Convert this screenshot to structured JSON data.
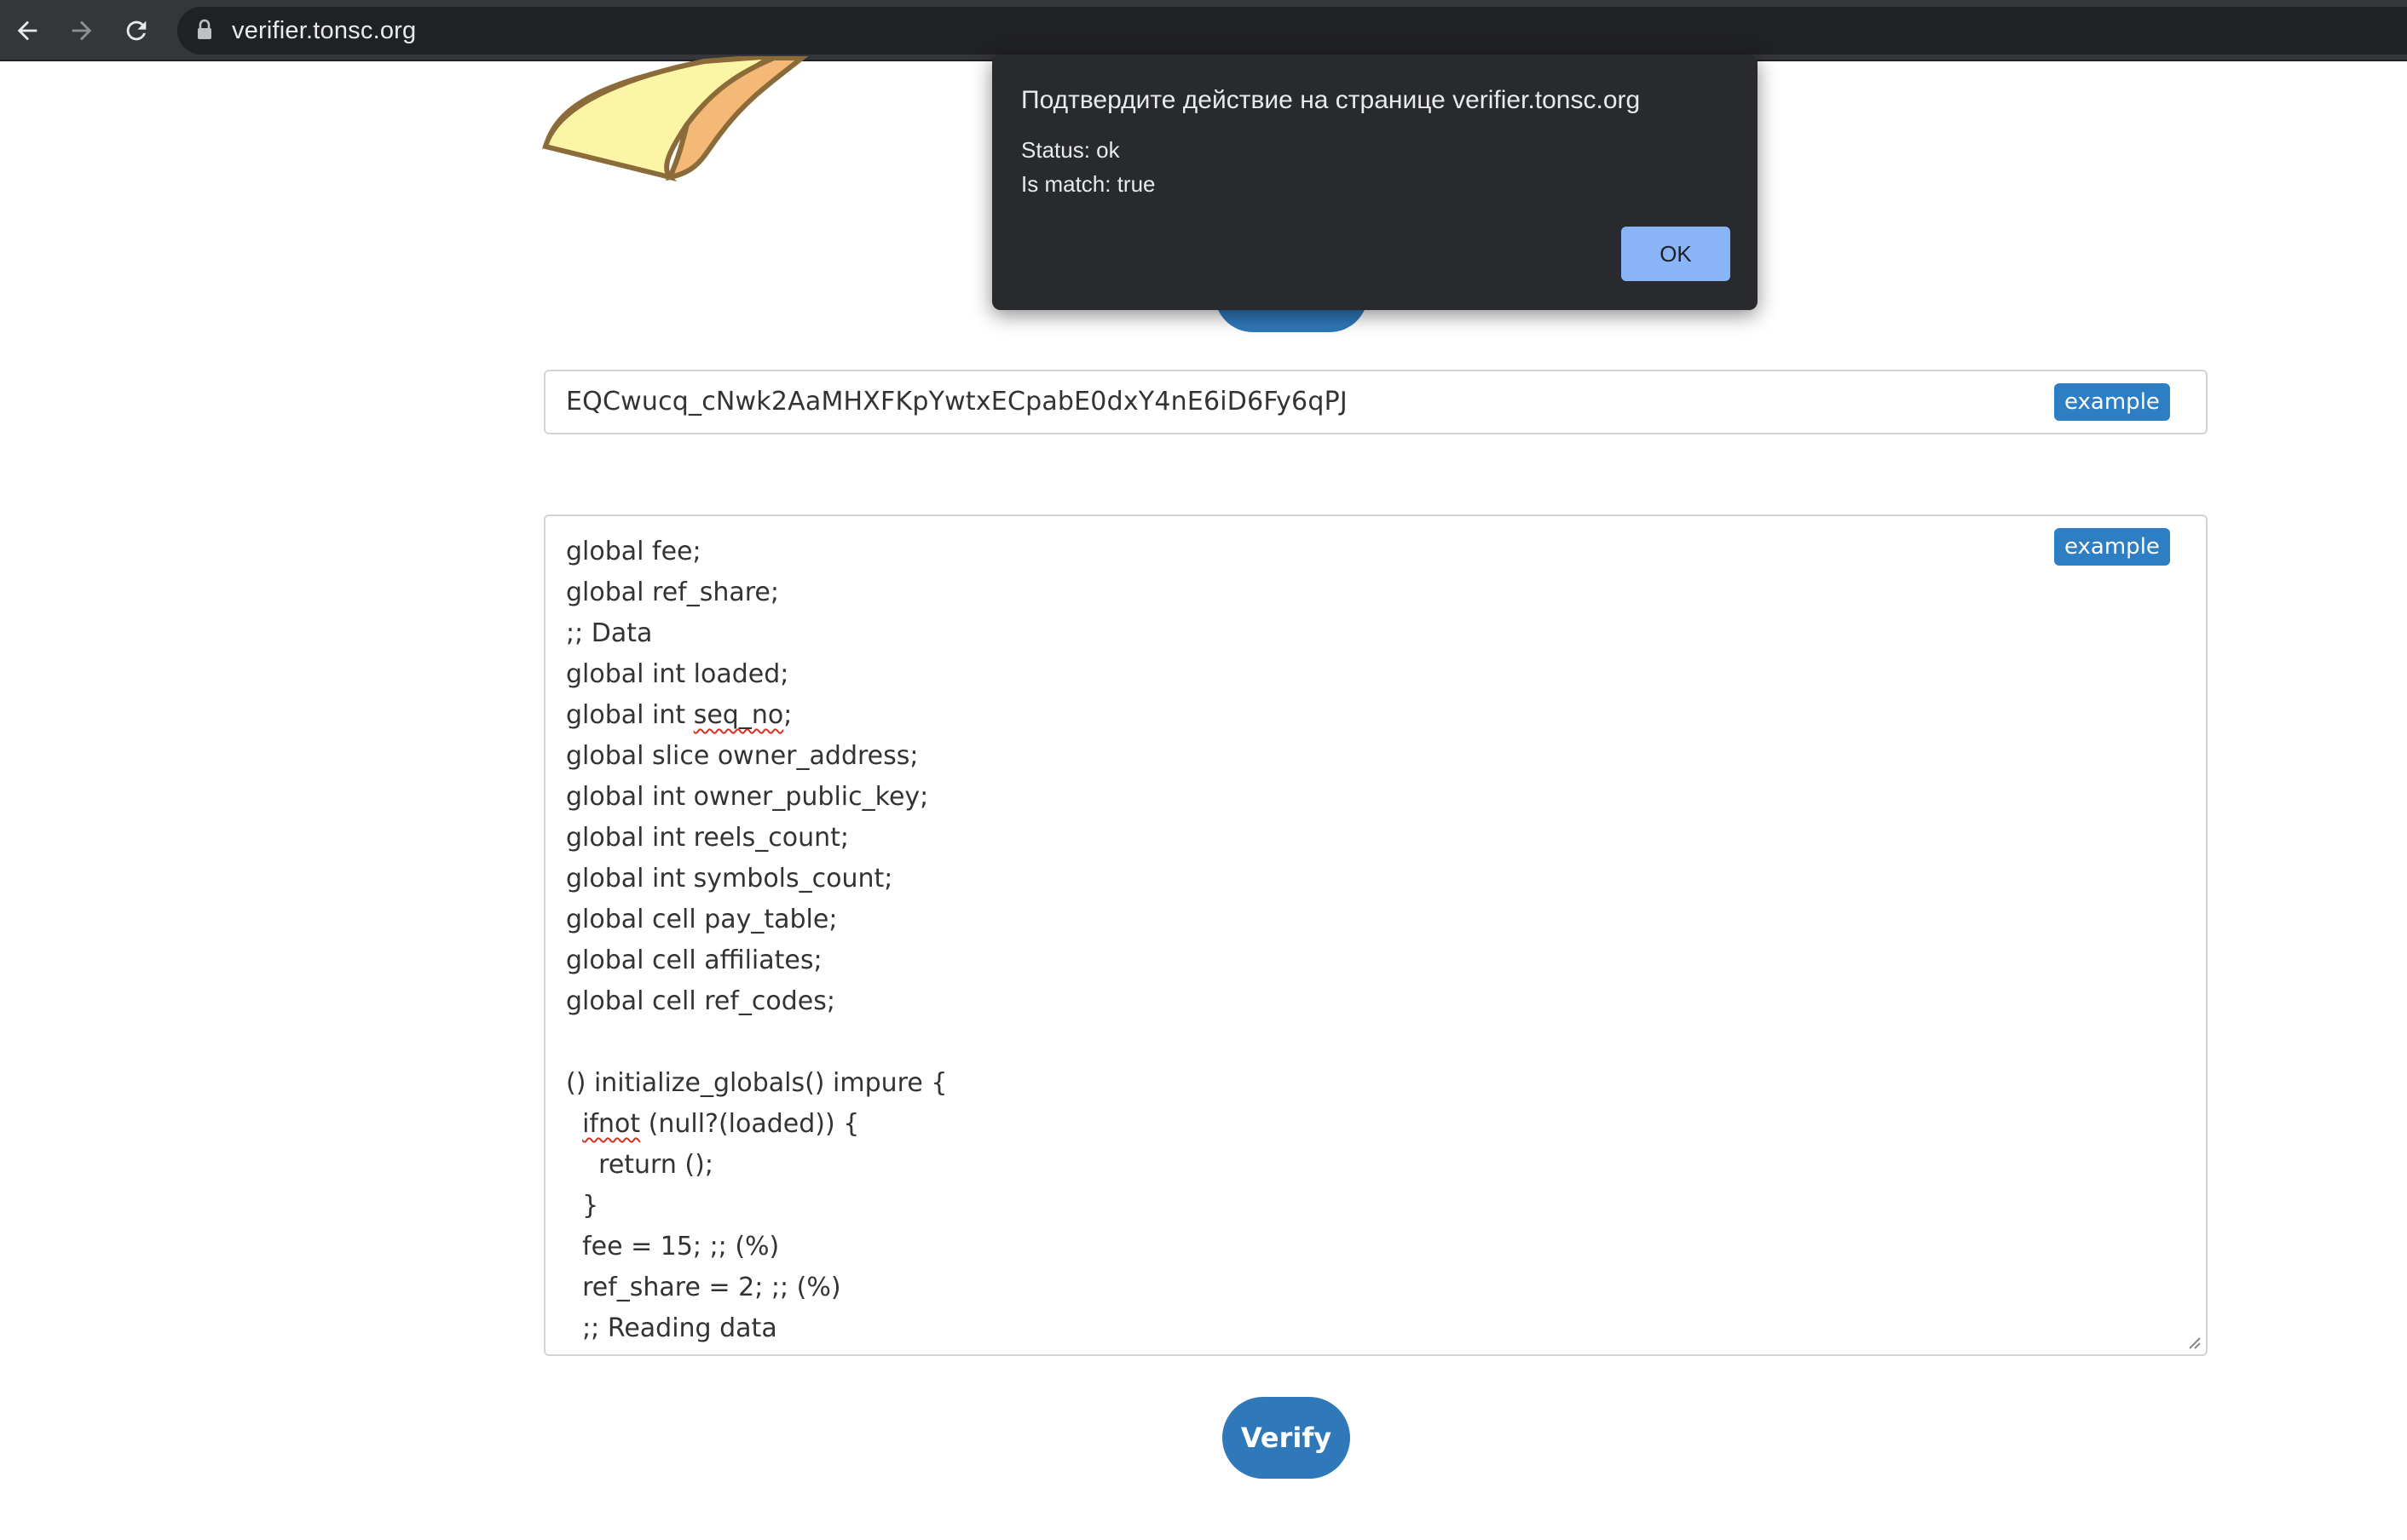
{
  "browser": {
    "url": "verifier.tonsc.org",
    "back_icon": "arrow-left-icon",
    "forward_icon": "arrow-right-icon",
    "reload_icon": "reload-icon",
    "lock_icon": "lock-icon"
  },
  "address": {
    "value": "EQCwucq_cNwk2AaMHXFKpYwtxECpabE0dxY4nE6iD6Fy6qPJ",
    "example_label": "example"
  },
  "code": {
    "example_label": "example",
    "lines": [
      "global fee;",
      "global ref_share;",
      ";; Data",
      "global int loaded;",
      "global int seq_no;",
      "global slice owner_address;",
      "global int owner_public_key;",
      "global int reels_count;",
      "global int symbols_count;",
      "global cell pay_table;",
      "global cell affiliates;",
      "global cell ref_codes;",
      "",
      "() initialize_globals() impure {",
      "  ifnot (null?(loaded)) {",
      "    return ();",
      "  }",
      "  fee = 15; ;; (%)",
      "  ref_share = 2; ;; (%)",
      "  ;; Reading data"
    ]
  },
  "verify_label": "Verify",
  "dialog": {
    "title": "Подтвердите действие на странице verifier.tonsc.org",
    "status": "Status: ok",
    "match": "Is match: true",
    "ok_label": "OK"
  },
  "colors": {
    "accent": "#2f78b9",
    "badge": "#2d7ec3",
    "dialog_bg": "#292a2d",
    "dialog_button": "#8ab4f8",
    "logo_fill": "#fdf5a6",
    "logo_edge": "#f4b877"
  }
}
